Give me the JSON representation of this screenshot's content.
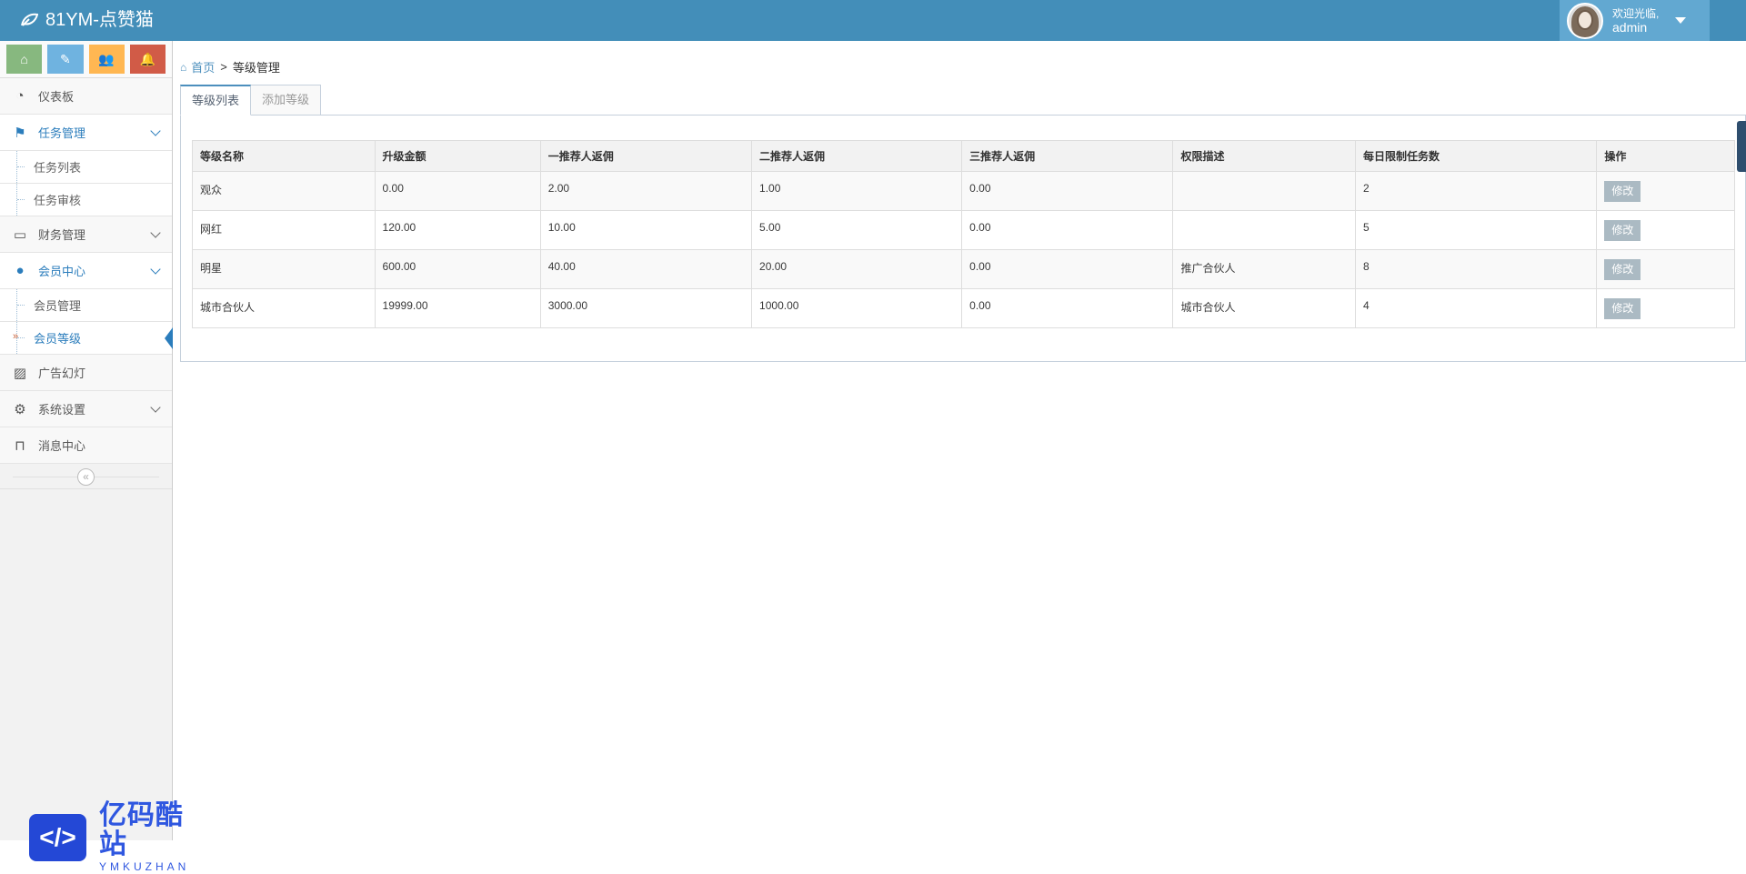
{
  "app": {
    "title": "81YM-点赞猫"
  },
  "user": {
    "welcome": "欢迎光临,",
    "name": "admin"
  },
  "shortcuts": [
    {
      "icon": "home-icon",
      "color": "#87b87f"
    },
    {
      "icon": "pencil-icon",
      "color": "#6fb3e0"
    },
    {
      "icon": "users-icon",
      "color": "#ffb752"
    },
    {
      "icon": "bell-icon",
      "color": "#d15b47"
    }
  ],
  "sidebar": {
    "dashboard": "仪表板",
    "task_mgmt": "任务管理",
    "task_list": "任务列表",
    "task_review": "任务审核",
    "finance": "财务管理",
    "member_center": "会员中心",
    "member_mgmt": "会员管理",
    "member_level": "会员等级",
    "ads": "广告幻灯",
    "settings": "系统设置",
    "messages": "消息中心"
  },
  "breadcrumb": {
    "home": "首页",
    "sep": ">",
    "current": "等级管理"
  },
  "tabs": [
    "等级列表",
    "添加等级"
  ],
  "table": {
    "headers": [
      "等级名称",
      "升级金额",
      "一推荐人返佣",
      "二推荐人返佣",
      "三推荐人返佣",
      "权限描述",
      "每日限制任务数",
      "操作"
    ],
    "rows": [
      [
        "观众",
        "0.00",
        "2.00",
        "1.00",
        "0.00",
        "",
        "2",
        "修改"
      ],
      [
        "网红",
        "120.00",
        "10.00",
        "5.00",
        "0.00",
        "",
        "5",
        "修改"
      ],
      [
        "明星",
        "600.00",
        "40.00",
        "20.00",
        "0.00",
        "推广合伙人",
        "8",
        "修改"
      ],
      [
        "城市合伙人",
        "19999.00",
        "3000.00",
        "1000.00",
        "0.00",
        "城市合伙人",
        "4",
        "修改"
      ]
    ]
  },
  "watermark": {
    "cn": "亿码酷站",
    "en": "YMKUZHAN"
  }
}
